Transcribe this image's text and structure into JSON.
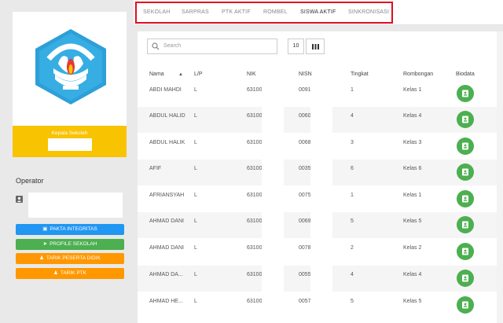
{
  "tabs": [
    "SEKOLAH",
    "SARPRAS",
    "PTK AKTIF",
    "ROMBEL",
    "SISWA AKTIF",
    "SINKRONISASI"
  ],
  "left": {
    "logo_text": "TUT WURI HANDAYANI",
    "kepala_sekolah_label": "Kepala Sekolah",
    "operator_title": "Operator",
    "buttons": {
      "pakta": "PAKTA INTEGRITAS",
      "profile": "PROFILE SEKOLAH",
      "tarik_pd": "TARIK PESERTA DIDIK",
      "tarik_ptk": "TARIK PTK"
    }
  },
  "toolbar": {
    "search_placeholder": "Search",
    "page_size": "10"
  },
  "table": {
    "headers": {
      "nama": "Nama",
      "lp": "L/P",
      "nik": "NIK",
      "nisn": "NISN",
      "tingkat": "Tingkat",
      "rombongan": "Rombongan",
      "biodata": "Biodata"
    },
    "rows": [
      {
        "nama": "ABDI MAHDI",
        "lp": "L",
        "nik": "63100",
        "nisn": "0091",
        "tingkat": "1",
        "rombongan": "Kelas 1"
      },
      {
        "nama": "ABDUL HALID",
        "lp": "L",
        "nik": "63100",
        "nisn": "0060",
        "tingkat": "4",
        "rombongan": "Kelas 4"
      },
      {
        "nama": "ABDUL HALIK",
        "lp": "L",
        "nik": "63100",
        "nisn": "0068",
        "tingkat": "3",
        "rombongan": "Kelas 3"
      },
      {
        "nama": "AFIF",
        "lp": "L",
        "nik": "63100",
        "nisn": "0035",
        "tingkat": "6",
        "rombongan": "Kelas 6"
      },
      {
        "nama": "AFRIANSYAH",
        "lp": "L",
        "nik": "63100",
        "nisn": "0075",
        "tingkat": "1",
        "rombongan": "Kelas 1"
      },
      {
        "nama": "AHMAD DANI",
        "lp": "L",
        "nik": "63100",
        "nisn": "0069",
        "tingkat": "5",
        "rombongan": "Kelas 5"
      },
      {
        "nama": "AHMAD DANI",
        "lp": "L",
        "nik": "63100",
        "nisn": "0078",
        "tingkat": "2",
        "rombongan": "Kelas 2"
      },
      {
        "nama": "AHMAD DA...",
        "lp": "L",
        "nik": "63100",
        "nisn": "0055",
        "tingkat": "4",
        "rombongan": "Kelas 4"
      },
      {
        "nama": "AHMAD HE...",
        "lp": "L",
        "nik": "63100",
        "nisn": "0057",
        "tingkat": "5",
        "rombongan": "Kelas 5"
      }
    ]
  },
  "colors": {
    "highlight": "#e00d1f",
    "kepala_sekolah_bg": "#f8c300",
    "pakta_bg": "#2196f3",
    "profile_bg": "#4caf50",
    "tarik_bg": "#ff9800",
    "biodata_btn": "#4caf50"
  }
}
